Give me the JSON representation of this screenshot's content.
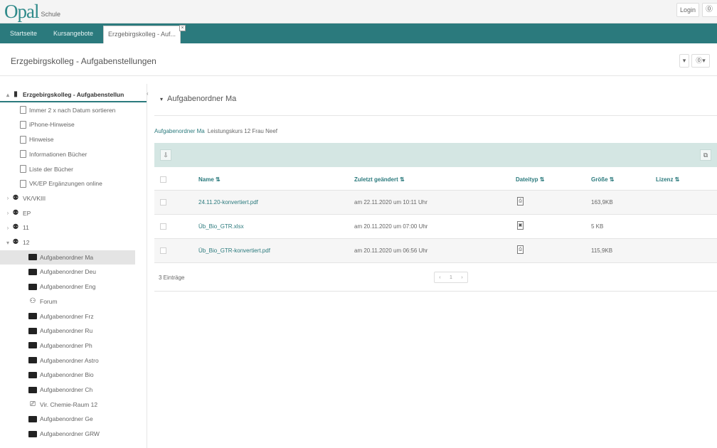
{
  "header": {
    "logo": "Opal",
    "logo_sub": "Schule",
    "login_label": "Login",
    "help_icon": "help-circle-icon"
  },
  "nav": {
    "tabs": [
      "Startseite",
      "Kursangebote",
      "Erzgebirgskolleg - Auf..."
    ],
    "close_icon": "close-icon"
  },
  "page": {
    "title": "Erzgebirgskolleg - Aufgabenstellungen",
    "dropdown_caret": "▾",
    "help_glyph": "⓪▾"
  },
  "sidebar": {
    "items": [
      {
        "label": "Erzgebirgskolleg - Aufgabenstellun",
        "type": "course",
        "toggle": "▴"
      },
      {
        "label": "Immer 2 x nach Datum sortieren",
        "type": "doc"
      },
      {
        "label": "iPhone-Hinweise",
        "type": "doc"
      },
      {
        "label": "Hinweise",
        "type": "doc"
      },
      {
        "label": "Informationen Bücher",
        "type": "doc"
      },
      {
        "label": "Liste der Bücher",
        "type": "doc"
      },
      {
        "label": "VK/EP Ergänzungen online",
        "type": "doc"
      },
      {
        "label": "VK/VKIII",
        "type": "group",
        "toggle": "›"
      },
      {
        "label": "EP",
        "type": "group",
        "toggle": "›"
      },
      {
        "label": "11",
        "type": "group",
        "toggle": "›"
      },
      {
        "label": "12",
        "type": "group",
        "toggle": "▾"
      },
      {
        "label": "Aufgabenordner Ma",
        "type": "folder",
        "selected": true
      },
      {
        "label": "Aufgabenordner Deu",
        "type": "folder"
      },
      {
        "label": "Aufgabenordner Eng",
        "type": "folder"
      },
      {
        "label": "Forum",
        "type": "forum"
      },
      {
        "label": "Aufgabenordner Frz",
        "type": "folder"
      },
      {
        "label": "Aufgabenordner Ru",
        "type": "folder"
      },
      {
        "label": "Aufgabenordner Ph",
        "type": "folder"
      },
      {
        "label": "Aufgabenordner Astro",
        "type": "folder"
      },
      {
        "label": "Aufgabenordner Bio",
        "type": "folder"
      },
      {
        "label": "Aufgabenordner Ch",
        "type": "folder"
      },
      {
        "label": "Vir. Chemie-Raum 12",
        "type": "virtual"
      },
      {
        "label": "Aufgabenordner Ge",
        "type": "folder"
      },
      {
        "label": "Aufgabenordner GRW",
        "type": "folder"
      }
    ],
    "collapse_glyph": "‹"
  },
  "main": {
    "folder_title": "Aufgabenordner Ma",
    "caret": "▾",
    "description_link": "Aufgabenordner Ma",
    "description_text": "Leistungskurs 12 Frau Neef",
    "toolbar": {
      "upload_glyph": "⇩",
      "copy_glyph": "⧉"
    },
    "columns": [
      "Name ⇅",
      "Zuletzt geändert ⇅",
      "Dateityp ⇅",
      "Größe ⇅",
      "Lizenz ⇅"
    ],
    "rows": [
      {
        "name": "24.11.20-konvertiert.pdf",
        "modified": "am 22.11.2020 um 10:11 Uhr",
        "type_glyph": "⎙",
        "size": "163,9KB"
      },
      {
        "name": "Üb_Bio_GTR.xlsx",
        "modified": "am 20.11.2020 um 07:00 Uhr",
        "type_glyph": "▣",
        "size": "5 KB"
      },
      {
        "name": "Üb_Bio_GTR-konvertiert.pdf",
        "modified": "am 20.11.2020 um 06:56 Uhr",
        "type_glyph": "⎙",
        "size": "115,9KB"
      }
    ],
    "entries": "3 Einträge",
    "pager": [
      "‹",
      "1",
      "›"
    ]
  }
}
